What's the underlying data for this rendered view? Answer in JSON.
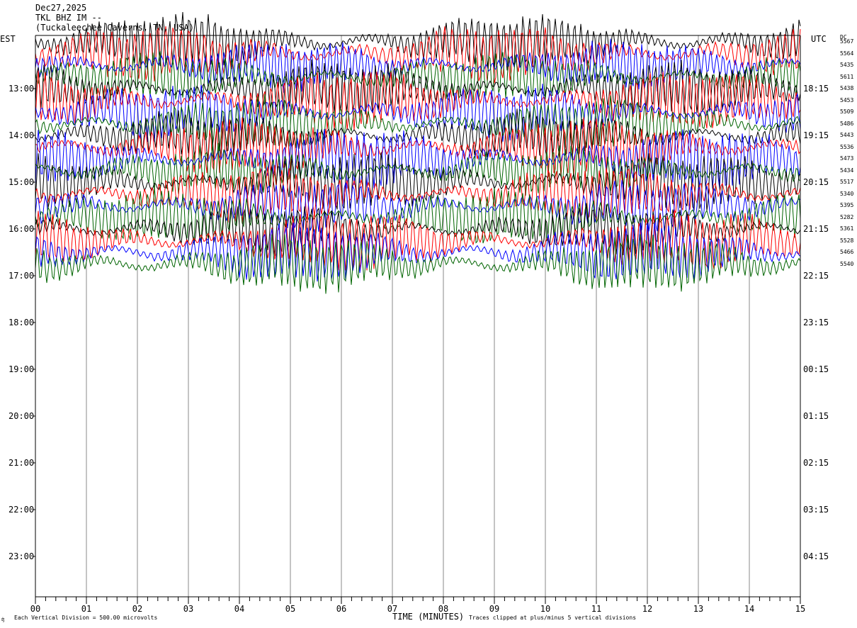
{
  "header": {
    "date": "Dec27,2025",
    "channel": "TKL BHZ IM --",
    "site": "(Tuckaleechee Caverns, TN, USA)"
  },
  "labels": {
    "left_zone": "EST",
    "right_zone": "UTC",
    "dc_header": "DC"
  },
  "chart_data": {
    "type": "line",
    "title": "",
    "xlabel": "TIME (MINUTES)",
    "xlim": [
      0,
      15
    ],
    "x_ticks": [
      "00",
      "01",
      "02",
      "03",
      "04",
      "05",
      "06",
      "07",
      "08",
      "09",
      "10",
      "11",
      "12",
      "13",
      "14",
      "15"
    ],
    "left_time_labels": [
      "13:00",
      "14:00",
      "15:00",
      "16:00",
      "17:00",
      "18:00",
      "19:00",
      "20:00",
      "21:00",
      "22:00",
      "23:00"
    ],
    "right_time_labels": [
      "18:15",
      "19:15",
      "20:15",
      "21:15",
      "22:15",
      "23:15",
      "00:15",
      "01:15",
      "02:15",
      "03:15",
      "04:15"
    ],
    "dc_offsets": [
      5567,
      5564,
      5435,
      5611,
      5438,
      5453,
      5509,
      5486,
      5443,
      5536,
      5473,
      5434,
      5517,
      5340,
      5395,
      5282,
      5361,
      5528,
      5466,
      5540
    ],
    "trace_colors": [
      "#000000",
      "#ff0000",
      "#0000ff",
      "#006400"
    ],
    "notes": {
      "vertical_division": "Each Vertical Division =  500.00 microvolts",
      "clipping": "Traces clipped at plus/minus 5 vertical divisions"
    }
  }
}
